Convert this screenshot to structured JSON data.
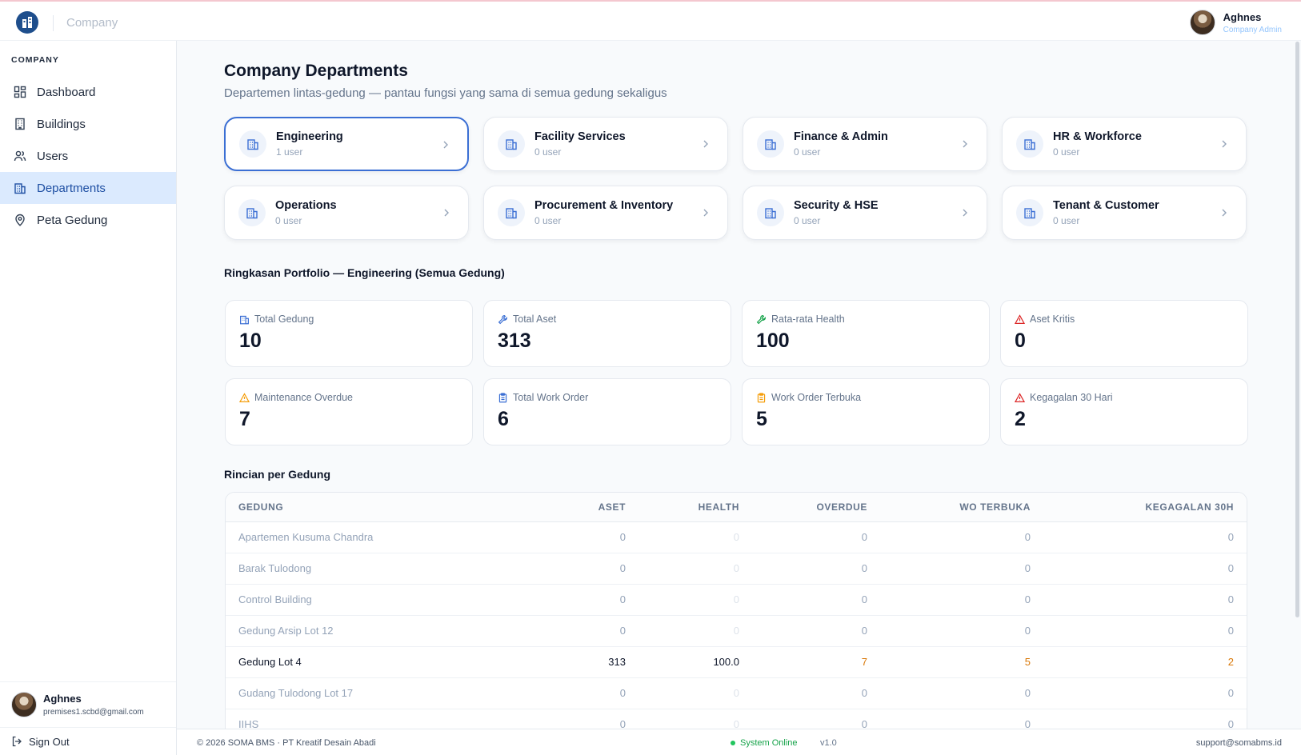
{
  "topbar": {
    "brand_label": "Company",
    "user_name": "Aghnes",
    "user_role": "Company Admin"
  },
  "sidebar": {
    "section_label": "COMPANY",
    "items": [
      {
        "label": "Dashboard",
        "icon": "dashboard-icon"
      },
      {
        "label": "Buildings",
        "icon": "building-icon"
      },
      {
        "label": "Users",
        "icon": "users-icon"
      },
      {
        "label": "Departments",
        "icon": "departments-icon",
        "active": true
      },
      {
        "label": "Peta Gedung",
        "icon": "map-pin-icon"
      }
    ],
    "user_name": "Aghnes",
    "user_email": "premises1.scbd@gmail.com",
    "sign_out": "Sign Out"
  },
  "page": {
    "title": "Company Departments",
    "subtitle": "Departemen lintas-gedung — pantau fungsi yang sama di semua gedung sekaligus"
  },
  "departments": [
    {
      "name": "Engineering",
      "count": "1 user",
      "selected": true
    },
    {
      "name": "Facility Services",
      "count": "0 user"
    },
    {
      "name": "Finance & Admin",
      "count": "0 user"
    },
    {
      "name": "HR & Workforce",
      "count": "0 user"
    },
    {
      "name": "Operations",
      "count": "0 user"
    },
    {
      "name": "Procurement & Inventory",
      "count": "0 user"
    },
    {
      "name": "Security & HSE",
      "count": "0 user"
    },
    {
      "name": "Tenant & Customer",
      "count": "0 user"
    }
  ],
  "summary": {
    "title": "Ringkasan Portfolio — Engineering (Semua Gedung)",
    "stats": [
      {
        "label": "Total Gedung",
        "value": "10",
        "icon": "building-icon",
        "color": "#3b6fd4"
      },
      {
        "label": "Total Aset",
        "value": "313",
        "icon": "wrench-icon",
        "color": "#3b6fd4"
      },
      {
        "label": "Rata-rata Health",
        "value": "100",
        "icon": "wrench-icon",
        "color": "#16a34a"
      },
      {
        "label": "Aset Kritis",
        "value": "0",
        "icon": "alert-triangle-icon",
        "color": "#dc2626"
      },
      {
        "label": "Maintenance Overdue",
        "value": "7",
        "icon": "alert-triangle-icon",
        "color": "#f59e0b"
      },
      {
        "label": "Total Work Order",
        "value": "6",
        "icon": "clipboard-icon",
        "color": "#3b6fd4"
      },
      {
        "label": "Work Order Terbuka",
        "value": "5",
        "icon": "clipboard-icon",
        "color": "#f59e0b"
      },
      {
        "label": "Kegagalan 30 Hari",
        "value": "2",
        "icon": "alert-triangle-icon",
        "color": "#dc2626"
      }
    ]
  },
  "breakdown": {
    "title": "Rincian per Gedung",
    "headers": [
      "GEDUNG",
      "ASET",
      "HEALTH",
      "OVERDUE",
      "WO TERBUKA",
      "KEGAGALAN 30H"
    ],
    "rows": [
      {
        "name": "Apartemen Kusuma Chandra",
        "aset": "0",
        "health": "0",
        "overdue": "0",
        "wo": "0",
        "fail": "0"
      },
      {
        "name": "Barak Tulodong",
        "aset": "0",
        "health": "0",
        "overdue": "0",
        "wo": "0",
        "fail": "0"
      },
      {
        "name": "Control Building",
        "aset": "0",
        "health": "0",
        "overdue": "0",
        "wo": "0",
        "fail": "0"
      },
      {
        "name": "Gedung Arsip Lot 12",
        "aset": "0",
        "health": "0",
        "overdue": "0",
        "wo": "0",
        "fail": "0"
      },
      {
        "name": "Gedung Lot 4",
        "aset": "313",
        "health": "100.0",
        "overdue": "7",
        "wo": "5",
        "fail": "2",
        "highlight": true
      },
      {
        "name": "Gudang Tulodong Lot 17",
        "aset": "0",
        "health": "0",
        "overdue": "0",
        "wo": "0",
        "fail": "0"
      },
      {
        "name": "IIHS",
        "aset": "0",
        "health": "0",
        "overdue": "0",
        "wo": "0",
        "fail": "0"
      }
    ]
  },
  "footer": {
    "copyright": "© 2026 SOMA BMS · PT Kreatif Desain Abadi",
    "status": "System Online",
    "version": "v1.0",
    "support": "support@somabms.id"
  }
}
